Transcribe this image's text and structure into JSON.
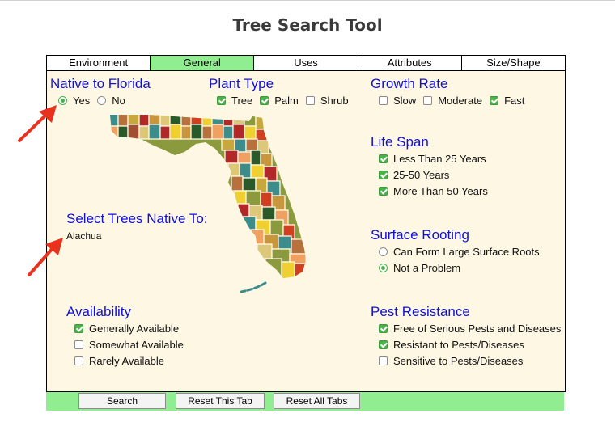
{
  "page": {
    "title": "Tree Search Tool"
  },
  "tabs": [
    {
      "label": "Environment",
      "active": false
    },
    {
      "label": "General",
      "active": true
    },
    {
      "label": "Uses",
      "active": false
    },
    {
      "label": "Attributes",
      "active": false
    },
    {
      "label": "Size/Shape",
      "active": false
    }
  ],
  "native": {
    "heading": "Native to Florida",
    "yes": {
      "label": "Yes",
      "selected": true
    },
    "no": {
      "label": "No",
      "selected": false
    }
  },
  "plant_type": {
    "heading": "Plant Type",
    "options": [
      {
        "label": "Tree",
        "checked": true
      },
      {
        "label": "Palm",
        "checked": true
      },
      {
        "label": "Shrub",
        "checked": false
      }
    ]
  },
  "native_to": {
    "heading": "Select Trees Native To:",
    "county": "Alachua"
  },
  "availability": {
    "heading": "Availability",
    "options": [
      {
        "label": "Generally Available",
        "checked": true
      },
      {
        "label": "Somewhat Available",
        "checked": false
      },
      {
        "label": "Rarely Available",
        "checked": false
      }
    ]
  },
  "growth_rate": {
    "heading": "Growth Rate",
    "options": [
      {
        "label": "Slow",
        "checked": false
      },
      {
        "label": "Moderate",
        "checked": false
      },
      {
        "label": "Fast",
        "checked": true
      }
    ]
  },
  "life_span": {
    "heading": "Life Span",
    "options": [
      {
        "label": "Less Than 25 Years",
        "checked": true
      },
      {
        "label": "25-50 Years",
        "checked": true
      },
      {
        "label": "More Than 50 Years",
        "checked": true
      }
    ]
  },
  "surface_rooting": {
    "heading": "Surface Rooting",
    "options": [
      {
        "label": "Can Form Large Surface Roots",
        "selected": false
      },
      {
        "label": "Not a Problem",
        "selected": true
      }
    ]
  },
  "pest_resistance": {
    "heading": "Pest Resistance",
    "options": [
      {
        "label": "Free of Serious Pests and Diseases",
        "checked": true
      },
      {
        "label": "Resistant to Pests/Diseases",
        "checked": true
      },
      {
        "label": "Sensitive to Pests/Diseases",
        "checked": false
      }
    ]
  },
  "buttons": {
    "search": "Search",
    "reset_tab": "Reset This Tab",
    "reset_all": "Reset All Tabs"
  },
  "colors": {
    "accent_green": "#90ee90",
    "heading_blue": "#1010dd",
    "panel_bg": "#fdf7e4",
    "annotation_red": "#e8321e"
  },
  "icons": {
    "map": "florida-county-map-icon",
    "annotation": "red-arrow-icon"
  }
}
